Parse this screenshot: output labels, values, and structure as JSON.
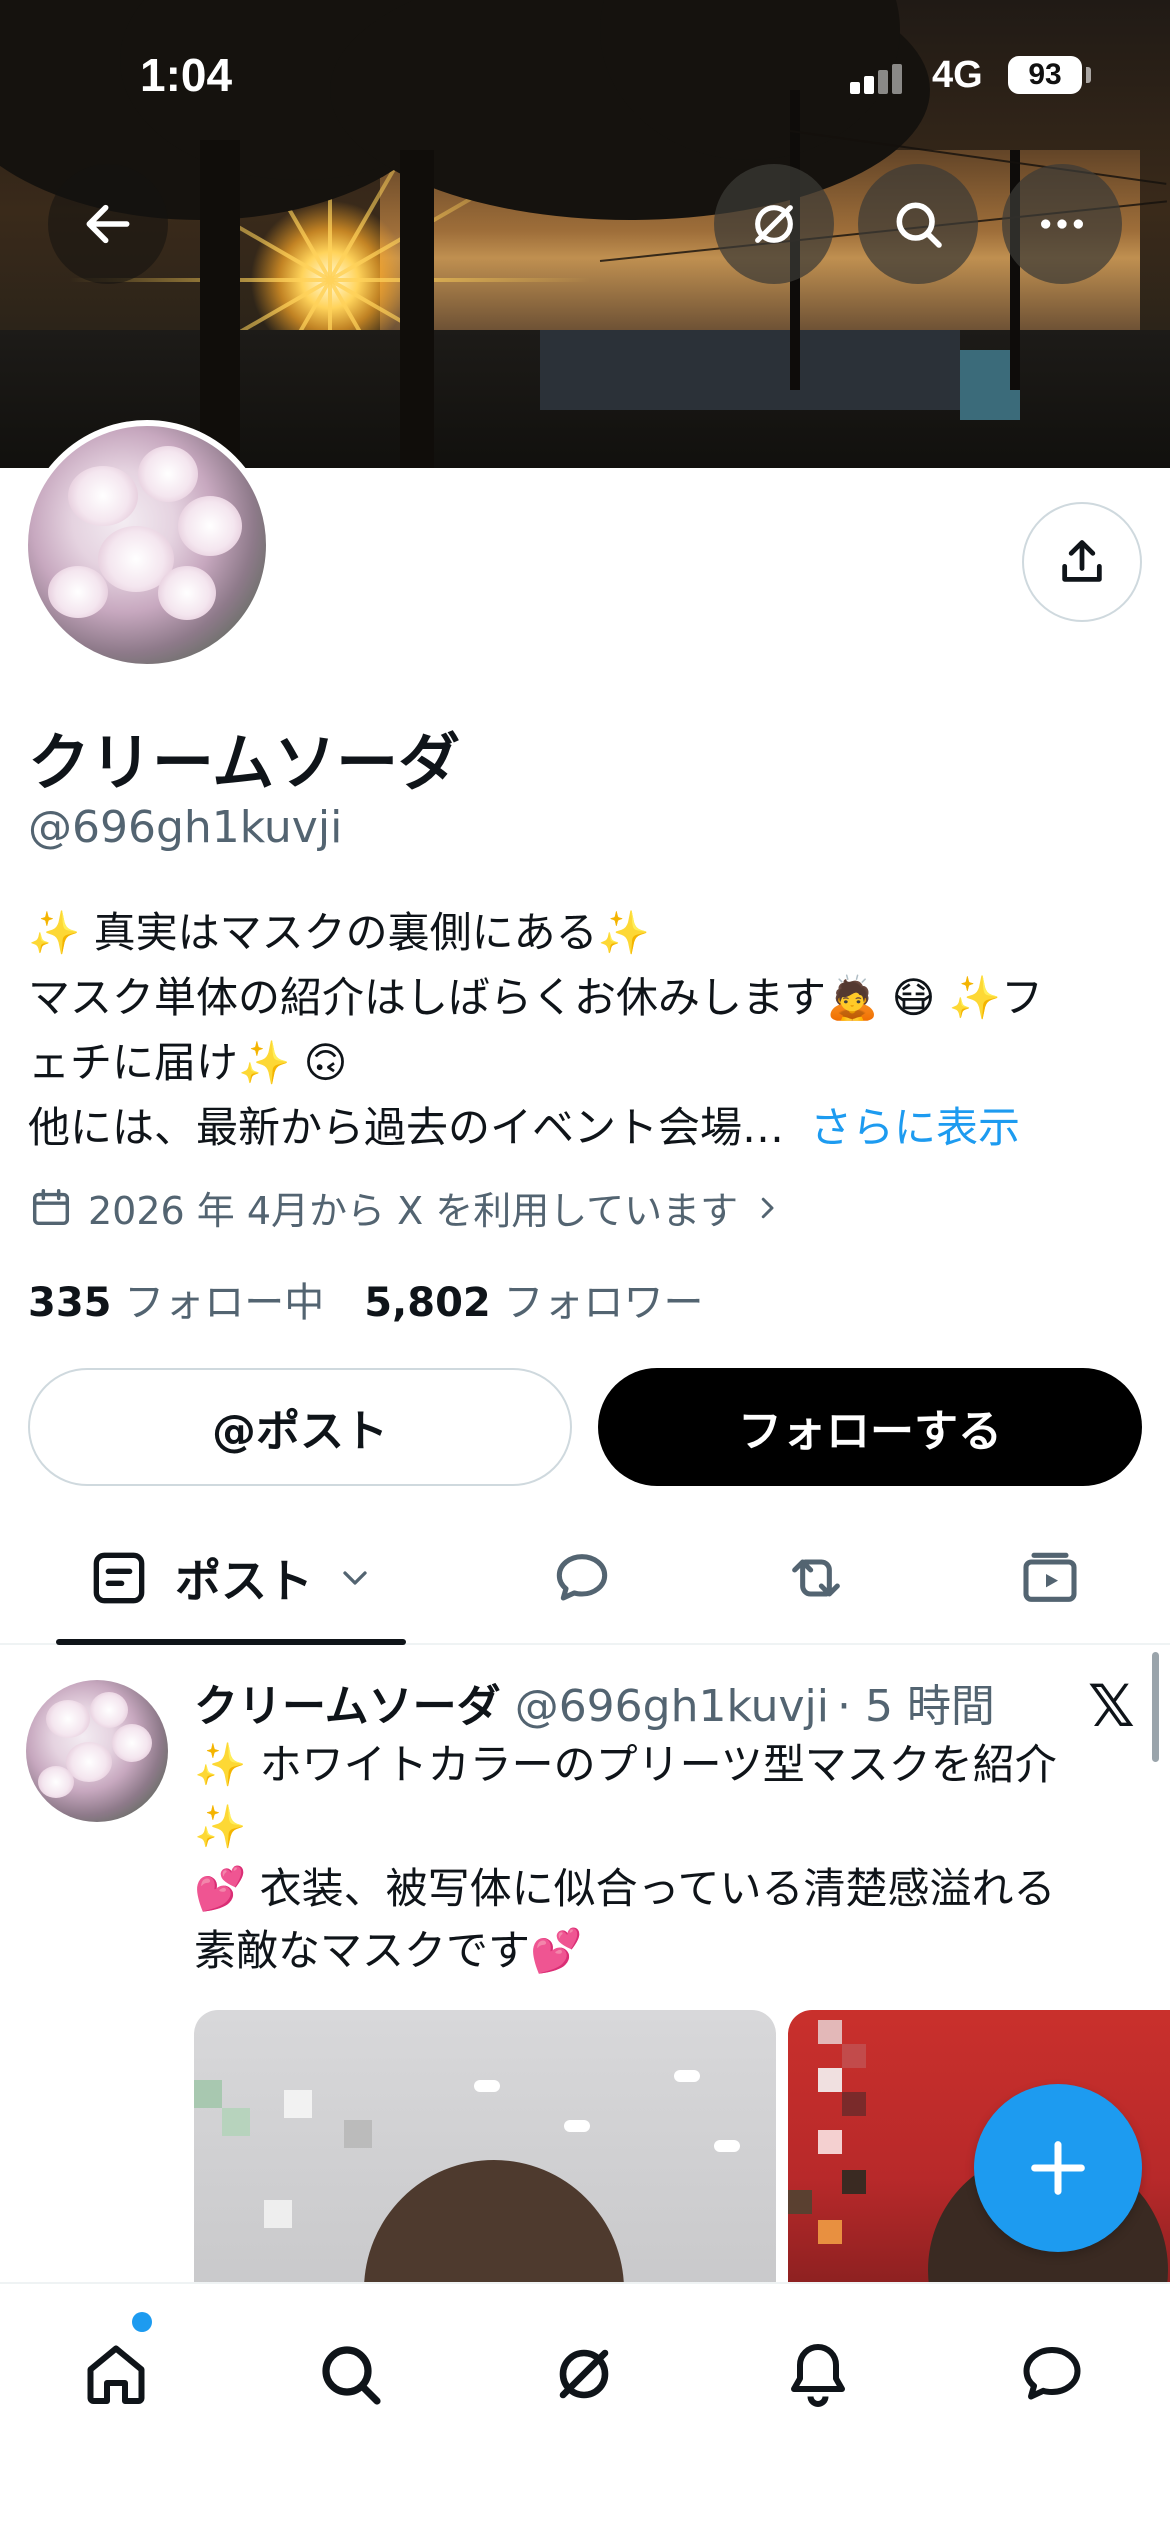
{
  "status_bar": {
    "time": "1:04",
    "network": "4G",
    "battery": "93"
  },
  "profile": {
    "display_name": "クリームソーダ",
    "handle": "@696gh1kuvji",
    "bio_lines": [
      "✨ 真実はマスクの裏側にある✨",
      "マスク単体の紹介はしばらくお休みします🙇 😷 ✨フ",
      "ェチに届け✨ 🙃",
      "他には、最新から過去のイベント会場…"
    ],
    "show_more": "さらに表示",
    "joined": "2026 年 4月から X を利用しています",
    "following_count": "335",
    "following_label": "フォロー中",
    "followers_count": "5,802",
    "followers_label": "フォロワー"
  },
  "actions": {
    "post_button": "@ポスト",
    "follow_button": "フォローする"
  },
  "tabs": {
    "posts_label": "ポスト"
  },
  "post": {
    "name": "クリームソーダ",
    "handle": "@696gh1kuvji",
    "time": "· 5 時間",
    "x_logo": "𝕏",
    "lines": [
      "✨ ホワイトカラーのプリーツ型マスクを紹介",
      "✨",
      "💕 衣装、被写体に似合っている清楚感溢れる",
      "素敵なマスクです💕"
    ]
  },
  "icons": {
    "back": "back-arrow-icon",
    "grok": "grok-icon",
    "search": "search-icon",
    "more": "more-icon",
    "share": "share-icon",
    "calendar": "calendar-icon",
    "compose": "plus-icon"
  },
  "colors": {
    "accent": "#1d9bf0",
    "text": "#0f1419",
    "secondary": "#536471"
  }
}
